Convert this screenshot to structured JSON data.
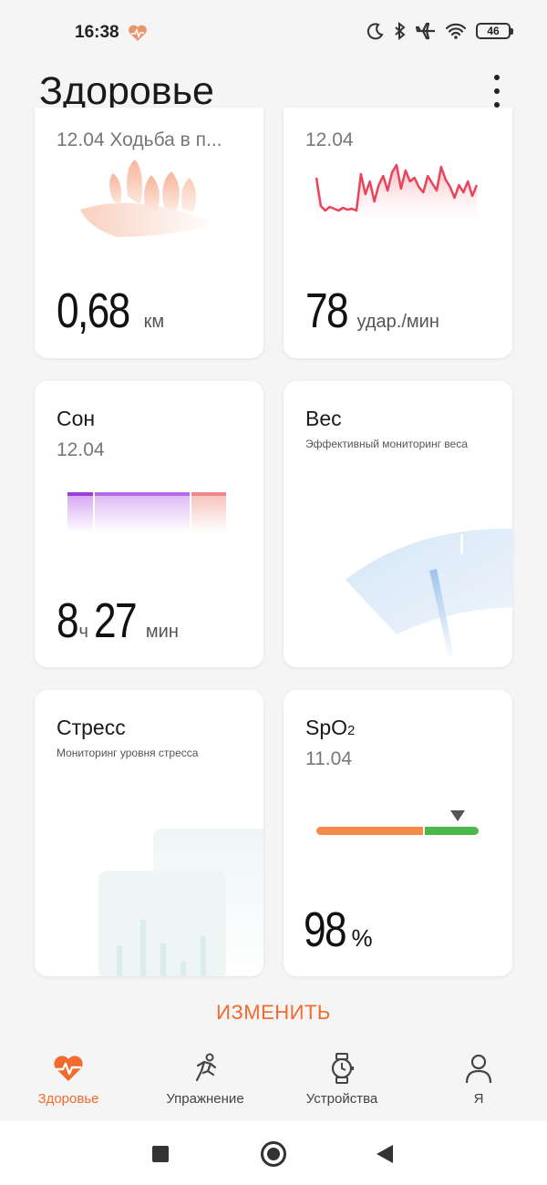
{
  "status": {
    "time": "16:38",
    "battery": "46"
  },
  "header": {
    "title": "Здоровье"
  },
  "cards": {
    "walk": {
      "date_label": "12.04 Ходьба в п...",
      "value": "0,68",
      "unit": "км"
    },
    "heart": {
      "date": "12.04",
      "value": "78",
      "unit": "удар./мин"
    },
    "sleep": {
      "title": "Сон",
      "date": "12.04",
      "hours": "8",
      "hours_unit": "ч",
      "minutes": "27",
      "minutes_unit": "мин"
    },
    "weight": {
      "title": "Вес",
      "subtitle": "Эффективный мониторинг веса"
    },
    "stress": {
      "title": "Стресс",
      "subtitle": "Мониторинг уровня стресса"
    },
    "spo2": {
      "title_main": "SpO",
      "title_sub": "2",
      "date": "11.04",
      "value": "98",
      "unit": "%",
      "level_fraction": 0.87
    }
  },
  "edit_button": "ИЗМЕНИТЬ",
  "tabs": [
    {
      "label": "Здоровье",
      "icon": "heart-pulse-icon",
      "active": true
    },
    {
      "label": "Упражнение",
      "icon": "running-icon",
      "active": false
    },
    {
      "label": "Устройства",
      "icon": "watch-icon",
      "active": false
    },
    {
      "label": "Я",
      "icon": "person-icon",
      "active": false
    }
  ],
  "colors": {
    "accent": "#f26a2e",
    "heart_line": "#e8445a",
    "sleep_purple": "#9b3fd6",
    "sleep_pink": "#f08a8a",
    "spo2_orange": "#f58a4b",
    "spo2_green": "#4cb84c"
  }
}
